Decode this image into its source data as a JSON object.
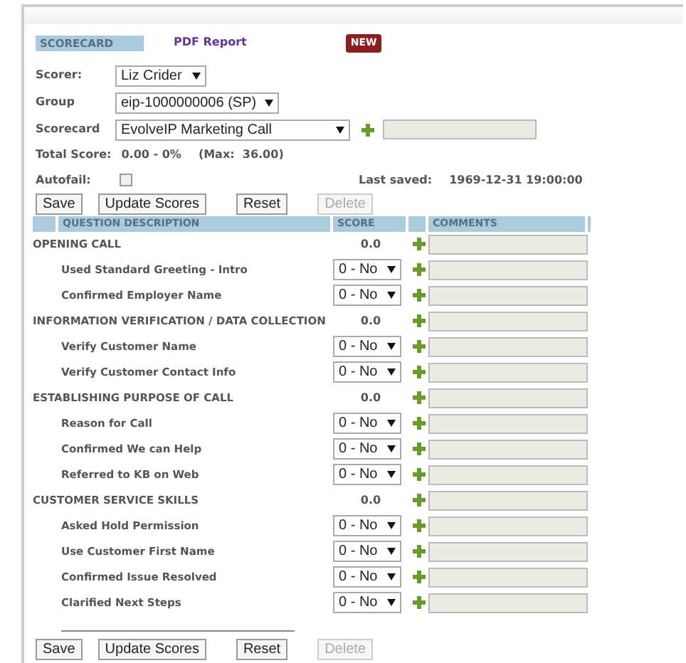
{
  "tab": {
    "label": "SCORECARD",
    "selected": true
  },
  "pdf_link": "PDF Report",
  "new_badge": "NEW",
  "fields": [
    {
      "label": "Scorer:",
      "value": "Liz Crider"
    },
    {
      "label": "Group",
      "value": "eip-1000000006 (SP)"
    },
    {
      "label": "Scorecard",
      "value": "EvolveIP Marketing Call"
    }
  ],
  "total_score": {
    "label": "Total Score:",
    "value": "0.00 - 0%",
    "max": "(Max:  36.00)"
  },
  "autofail": {
    "label": "Autofail:",
    "checked": false
  },
  "last_saved": {
    "label": "Last saved:",
    "value": "1969-12-31 19:00:00"
  },
  "buttons": [
    {
      "label": "Save",
      "disabled": false
    },
    {
      "label": "Update Scores",
      "disabled": false
    },
    {
      "label": "Reset",
      "disabled": false
    },
    {
      "label": "Delete",
      "disabled": true
    }
  ],
  "table": {
    "columns": [
      "QUESTION DESCRIPTION",
      "SCORE",
      "COMMENTS"
    ],
    "rows": [
      {
        "kind": "section",
        "text": "OPENING CALL",
        "score": "0.0"
      },
      {
        "kind": "question",
        "text": "Used Standard Greeting - Intro",
        "score": "0 - No"
      },
      {
        "kind": "question",
        "text": "Confirmed Employer Name",
        "score": "0 - No"
      },
      {
        "kind": "section",
        "text": "INFORMATION VERIFICATION / DATA COLLECTION",
        "score": "0.0"
      },
      {
        "kind": "question",
        "text": "Verify Customer Name",
        "score": "0 - No"
      },
      {
        "kind": "question",
        "text": "Verify Customer Contact Info",
        "score": "0 - No"
      },
      {
        "kind": "section",
        "text": "ESTABLISHING PURPOSE OF CALL",
        "score": "0.0"
      },
      {
        "kind": "question",
        "text": "Reason for Call",
        "score": "0 - No"
      },
      {
        "kind": "question",
        "text": "Confirmed We can Help",
        "score": "0 - No"
      },
      {
        "kind": "question",
        "text": "Referred to KB on Web",
        "score": "0 - No"
      },
      {
        "kind": "section",
        "text": "CUSTOMER SERVICE SKILLS",
        "score": "0.0"
      },
      {
        "kind": "question",
        "text": "Asked Hold Permission",
        "score": "0 - No"
      },
      {
        "kind": "question",
        "text": "Use Customer First Name",
        "score": "0 - No"
      },
      {
        "kind": "question",
        "text": "Confirmed Issue Resolved",
        "score": "0 - No"
      },
      {
        "kind": "question",
        "text": "Clarified Next Steps",
        "score": "0 - No"
      }
    ]
  },
  "bottom_buttons": [
    {
      "label": "Save",
      "disabled": false
    },
    {
      "label": "Update Scores",
      "disabled": false
    },
    {
      "label": "Reset",
      "disabled": false
    },
    {
      "label": "Delete",
      "disabled": true
    }
  ]
}
